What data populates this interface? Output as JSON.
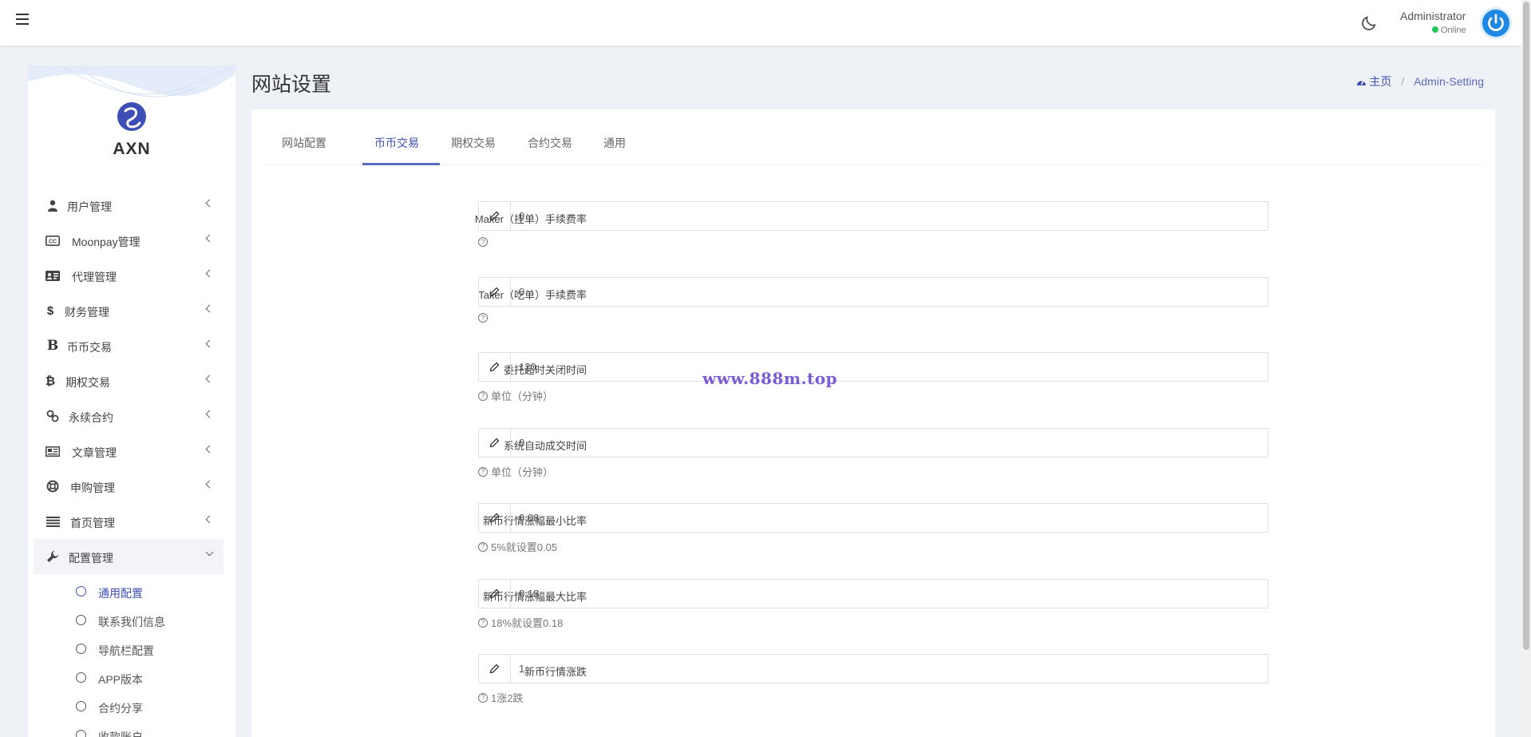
{
  "header": {
    "user_name": "Administrator",
    "user_status": "Online"
  },
  "sidebar": {
    "brand": "AXN",
    "items": [
      {
        "label": "用户管理",
        "icon": "user-tie-icon"
      },
      {
        "label": "Moonpay管理",
        "icon": "closed-captioning-icon"
      },
      {
        "label": "代理管理",
        "icon": "address-card-icon"
      },
      {
        "label": "财务管理",
        "icon": "dollar-icon"
      },
      {
        "label": "币币交易",
        "icon": "bold-b-icon"
      },
      {
        "label": "期权交易",
        "icon": "bitcoin-icon"
      },
      {
        "label": "永续合约",
        "icon": "link-icon"
      },
      {
        "label": "文章管理",
        "icon": "newspaper-icon"
      },
      {
        "label": "申购管理",
        "icon": "life-ring-icon"
      },
      {
        "label": "首页管理",
        "icon": "list-icon"
      },
      {
        "label": "配置管理",
        "icon": "wrench-icon"
      }
    ],
    "submenu": [
      {
        "label": "通用配置",
        "active": true
      },
      {
        "label": "联系我们信息"
      },
      {
        "label": "导航栏配置"
      },
      {
        "label": "APP版本"
      },
      {
        "label": "合约分享"
      },
      {
        "label": "收款账户"
      }
    ]
  },
  "main": {
    "title": "网站设置",
    "breadcrumb": {
      "home": "主页",
      "current": "Admin-Setting"
    },
    "tabs": [
      "网站配置",
      "币币交易",
      "期权交易",
      "合约交易",
      "通用"
    ],
    "active_tab": "币币交易",
    "fields": [
      {
        "label": "Maker（挂单）手续费率",
        "value": "0",
        "help": ""
      },
      {
        "label": "Taker（吃单）手续费率",
        "value": "0",
        "help": ""
      },
      {
        "label": "委托超时关闭时间",
        "value": "120",
        "help": "单位（分钟）"
      },
      {
        "label": "系统自动成交时间",
        "value": "0",
        "help": "单位（分钟）"
      },
      {
        "label": "新币行情涨幅最小比率",
        "value": "0.08",
        "help": "5%就设置0.05"
      },
      {
        "label": "新币行情涨幅最大比率",
        "value": "0.18",
        "help": "18%就设置0.18"
      },
      {
        "label": "新币行情涨跌",
        "value": "1",
        "help": "1涨2跌"
      }
    ]
  },
  "watermark": "www.888m.top",
  "colors": {
    "accent": "#3d4fb4",
    "online": "#22c55e",
    "avatar": "#1e88e5",
    "watermark": "#7b5cd6"
  }
}
